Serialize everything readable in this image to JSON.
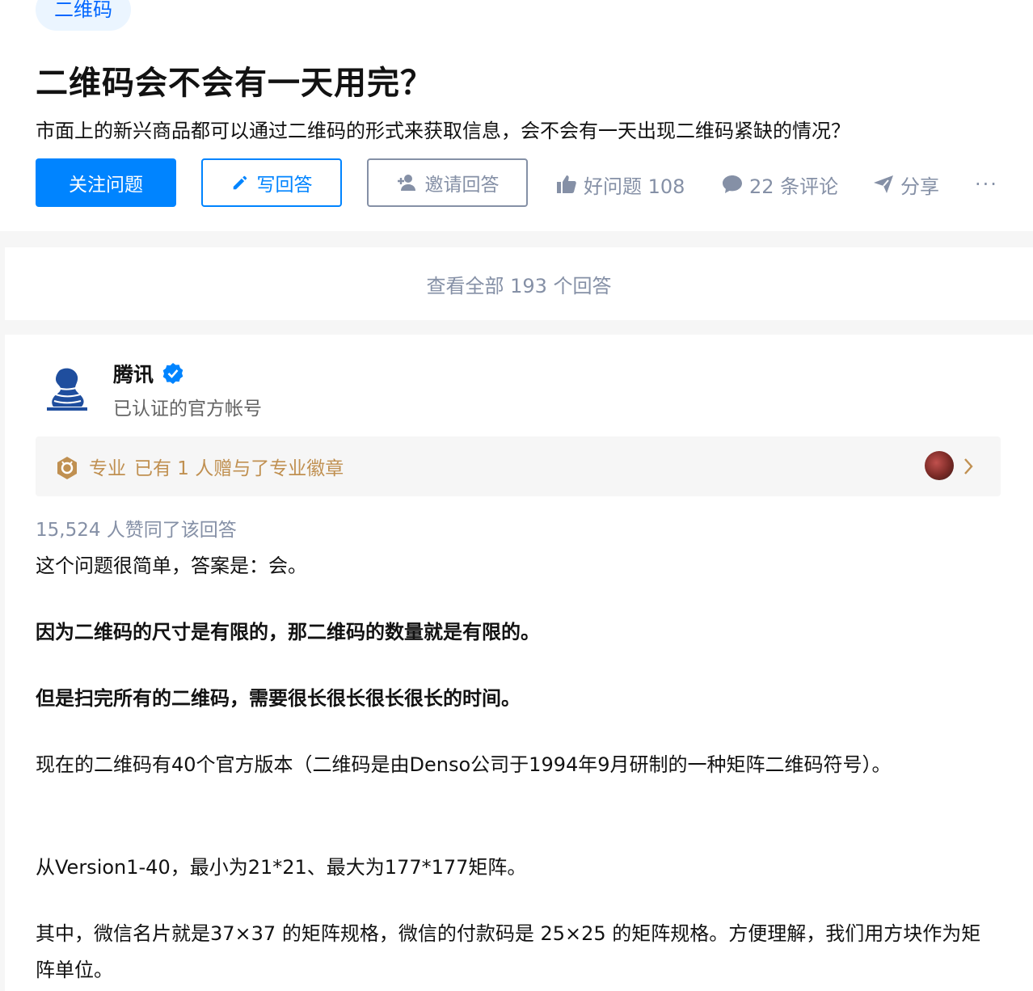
{
  "question": {
    "topic": "二维码",
    "title": "二维码会不会有一天用完？",
    "detail": "市面上的新兴商品都可以通过二维码的形式来获取信息，会不会有一天出现二维码紧缺的情况？"
  },
  "actions": {
    "follow": "关注问题",
    "write": "写回答",
    "invite": "邀请回答",
    "good": "好问题 108",
    "comments": "22 条评论",
    "share": "分享",
    "more": "···"
  },
  "all_answers": "查看全部 193 个回答",
  "answer": {
    "author": "腾讯",
    "author_desc": "已认证的官方帐号",
    "badge_type": "专业",
    "badge_text": "已有 1 人赠与了专业徽章",
    "votes": "15,524 人赞同了该回答",
    "paragraphs": [
      "这个问题很简单，答案是：会。",
      "因为二维码的尺寸是有限的，那二维码的数量就是有限的。",
      "但是扫完所有的二维码，需要很长很长很长很长的时间。",
      "现在的二维码有40个官方版本（二维码是由Denso公司于1994年9月研制的一种矩阵二维码符号）。",
      "从Version1-40，最小为21*21、最大为177*177矩阵。",
      "其中，微信名片就是37×37 的矩阵规格，微信的付款码是 25×25 的矩阵规格。方便理解，我们用方块作为矩阵单位。"
    ]
  },
  "colors": {
    "accent": "#0084ff",
    "muted": "#8590a6",
    "badge": "#c09051"
  }
}
